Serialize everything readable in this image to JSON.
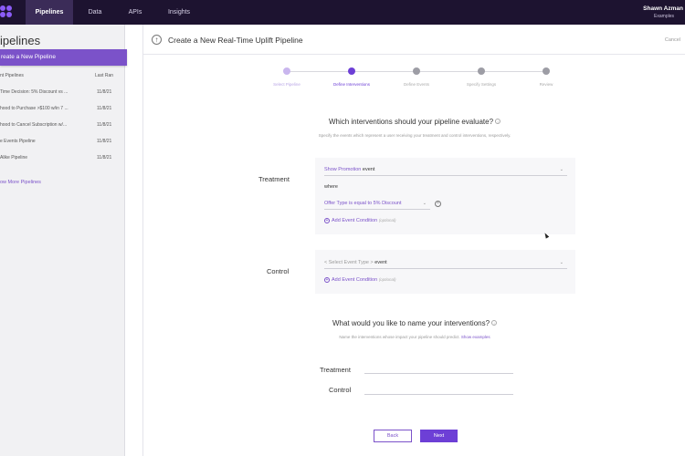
{
  "topnav": {
    "items": [
      {
        "label": "Pipelines",
        "active": true
      },
      {
        "label": "Data",
        "active": false
      },
      {
        "label": "APIs",
        "active": false
      },
      {
        "label": "Insights",
        "active": false
      }
    ],
    "user_name": "Shawn Azman",
    "user_sub": "Examples"
  },
  "sidebar": {
    "title": "ipelines",
    "create_label": "reate a New Pipeline",
    "list_header_name": "nt Pipelines",
    "list_header_date": "Last Ran",
    "rows": [
      {
        "name": "Time Decision: 5% Discount vs ...",
        "date": "11/8/21"
      },
      {
        "name": "hood to Purchase >$100 w/in 7 ...",
        "date": "11/8/21"
      },
      {
        "name": "hood to Cancel Subscription w/...",
        "date": "11/8/21"
      },
      {
        "name": "e Events Pipeline",
        "date": "11/8/21"
      },
      {
        "name": "Alike Pipeline",
        "date": "11/8/21"
      }
    ],
    "show_more": "ow More Pipelines"
  },
  "header": {
    "title": "Create a New Real-Time Uplift Pipeline",
    "cancel": "Cancel",
    "back_glyph": "↑"
  },
  "steps": [
    {
      "label": "Select Pipeline",
      "state": "done"
    },
    {
      "label": "Define Interventions",
      "state": "current"
    },
    {
      "label": "Define Events",
      "state": "todo"
    },
    {
      "label": "Specify Settings",
      "state": "todo"
    },
    {
      "label": "Review",
      "state": "todo"
    }
  ],
  "interventions": {
    "title": "Which interventions should your pipeline evaluate?",
    "subtitle": "Specify the events which represent a user receiving your treatment and control interventions, respectively.",
    "treatment": {
      "label": "Treatment",
      "event_type": "Show Promotion",
      "event_word": "event",
      "where": "where",
      "condition": "Offer Type is equal to 5% Discount",
      "add_condition": "Add Event Condition",
      "optional": "(optional)"
    },
    "control": {
      "label": "Control",
      "event_type_placeholder": "< Select Event Type >",
      "event_word": "event",
      "add_condition": "Add Event Condition",
      "optional": "(optional)"
    }
  },
  "naming": {
    "title": "What would you like to name your interventions?",
    "subtitle": "Name the interventions whose impact your pipeline should predict.",
    "show_examples": "Show examples",
    "treatment_label": "Treatment",
    "control_label": "Control"
  },
  "footer": {
    "back": "Back",
    "next": "Next"
  },
  "colors": {
    "topbar": "#1d1330",
    "accent": "#7b52c9",
    "step_done": "#c9b6ee",
    "step_current": "#6d3fd6",
    "step_todo": "#9d9da5"
  },
  "icons": {
    "info": "info-icon",
    "chevron": "chevron-down-icon",
    "add": "plus-circle-icon",
    "remove": "x-circle-icon"
  }
}
